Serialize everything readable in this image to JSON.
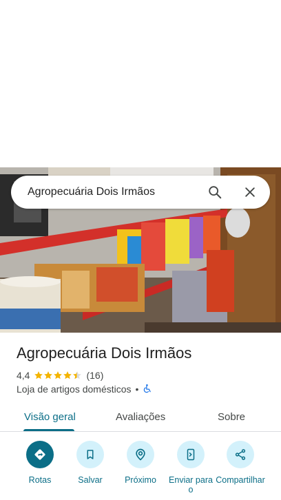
{
  "search": {
    "query": "Agropecuária Dois Irmãos"
  },
  "place": {
    "name": "Agropecuária Dois Irmãos",
    "rating": "4,4",
    "stars": 4.4,
    "review_count": "(16)",
    "category": "Loja de artigos domésticos",
    "separator": "•"
  },
  "tabs": [
    {
      "label": "Visão geral",
      "active": true
    },
    {
      "label": "Avaliações",
      "active": false
    },
    {
      "label": "Sobre",
      "active": false
    }
  ],
  "actions": [
    {
      "label": "Rotas",
      "icon": "directions-icon",
      "primary": true
    },
    {
      "label": "Salvar",
      "icon": "bookmark-icon",
      "primary": false
    },
    {
      "label": "Próximo",
      "icon": "nearby-icon",
      "primary": false
    },
    {
      "label": "Enviar para o",
      "icon": "send-to-phone-icon",
      "primary": false
    },
    {
      "label": "Compartilhar",
      "icon": "share-icon",
      "primary": false
    }
  ],
  "colors": {
    "accent": "#0b6e87",
    "action_bg": "#d3f1fb",
    "star": "#f4b400"
  }
}
